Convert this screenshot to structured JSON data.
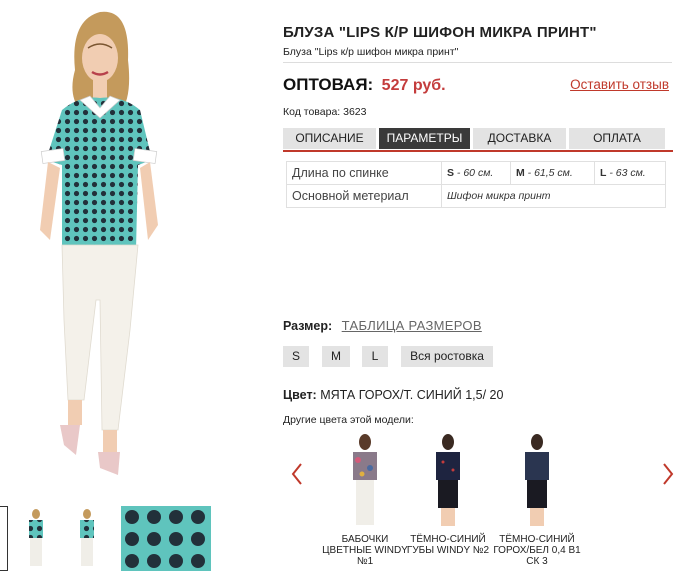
{
  "product": {
    "title": "БЛУЗА \"LIPS К/Р ШИФОН МИКРА ПРИНТ\"",
    "subtitle": "Блуза \"Lips к/р шифон микра принт\"",
    "price_label": "ОПТОВАЯ:",
    "price_value": "527 руб.",
    "review_link": "Оставить отзыв",
    "sku": "Код товара: 3623"
  },
  "tabs": [
    {
      "label": "ОПИСАНИЕ",
      "active": false
    },
    {
      "label": "ПАРАМЕТРЫ",
      "active": true
    },
    {
      "label": "ДОСТАВКА",
      "active": false
    },
    {
      "label": "ОПЛАТА",
      "active": false
    }
  ],
  "params": {
    "length_label": "Длина по спинке",
    "length_s_size": "S",
    "length_s_value": " - 60 см.",
    "length_m_size": "M",
    "length_m_value": " - 61,5 см.",
    "length_l_size": "L",
    "length_l_value": " - 63 см.",
    "material_label": "Основной метериал",
    "material_value": "Шифон микра принт"
  },
  "size": {
    "label": "Размер:",
    "table_link": "ТАБЛИЦА РАЗМЕРОВ",
    "options": [
      "S",
      "M",
      "L",
      "Вся ростовка"
    ]
  },
  "color": {
    "label": "Цвет:",
    "value": "МЯТА ГОРОХ/Т. СИНИЙ 1,5/ 20"
  },
  "other_colors": {
    "label": "Другие цвета этой модели:",
    "items": [
      {
        "name": "БАБОЧКИ ЦВЕТНЫЕ WINDY №1"
      },
      {
        "name": "ТЁМНО-СИНИЙ ГУБЫ WINDY №2"
      },
      {
        "name": "ТЁМНО-СИНИЙ ГОРОХ/БЕЛ 0,4 В1 СК 3"
      }
    ]
  },
  "colors": {
    "accent": "#c0392b",
    "price": "#c43c3c",
    "tab_active": "#3a3a3a",
    "tab_inactive": "#e3e3e3",
    "blouse_mint": "#5fc4bd"
  },
  "icons": {
    "prev": "chevron-left-icon",
    "next": "chevron-right-icon"
  }
}
